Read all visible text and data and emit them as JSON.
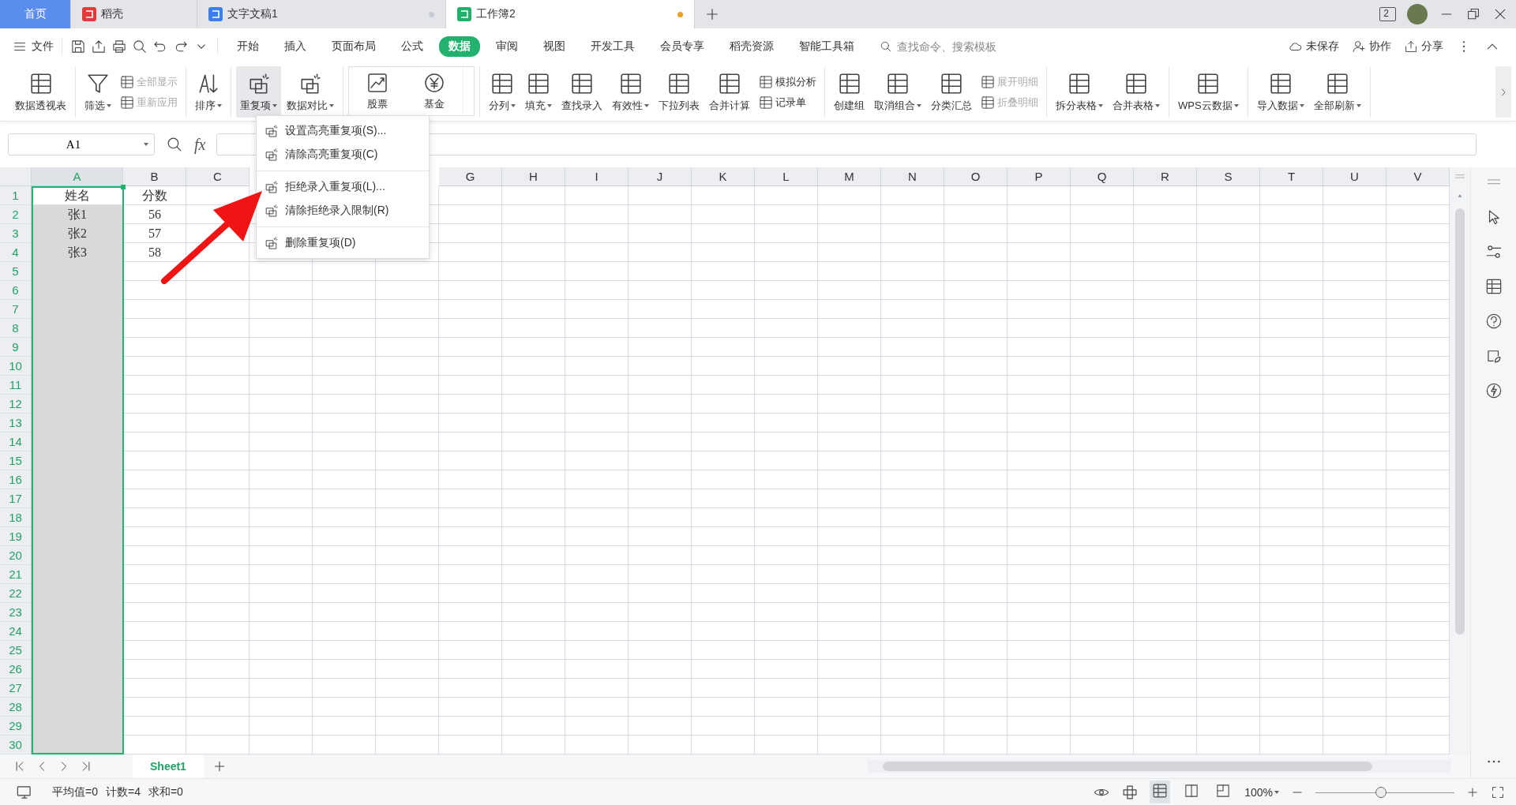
{
  "window_tabs": [
    {
      "kind": "home",
      "label": "首页",
      "selected": false
    },
    {
      "kind": "web",
      "label": "稻壳",
      "selected": false
    },
    {
      "kind": "doc",
      "label": "文字文稿1",
      "selected": false,
      "modified": false
    },
    {
      "kind": "sheet",
      "label": "工作簿2",
      "selected": true,
      "modified": true
    }
  ],
  "window_count": "2",
  "file_menu": "文件",
  "menu_tabs": [
    {
      "label": "开始",
      "selected": false
    },
    {
      "label": "插入",
      "selected": false
    },
    {
      "label": "页面布局",
      "selected": false
    },
    {
      "label": "公式",
      "selected": false
    },
    {
      "label": "数据",
      "selected": true
    },
    {
      "label": "审阅",
      "selected": false
    },
    {
      "label": "视图",
      "selected": false
    },
    {
      "label": "开发工具",
      "selected": false
    },
    {
      "label": "会员专享",
      "selected": false
    },
    {
      "label": "稻壳资源",
      "selected": false
    },
    {
      "label": "智能工具箱",
      "selected": false
    }
  ],
  "search": {
    "placeholder": "查找命令、搜索模板"
  },
  "header_actions": [
    "未保存",
    "协作",
    "分享"
  ],
  "ribbon": [
    {
      "items": [
        {
          "kind": "large",
          "label": "数据透视表",
          "dropdown": false,
          "selected": false
        }
      ]
    },
    {
      "items": [
        {
          "kind": "large",
          "label": "筛选",
          "dropdown": true,
          "selected": false
        },
        {
          "kind": "stack",
          "items": [
            {
              "label": "全部显示",
              "disabled": true
            },
            {
              "label": "重新应用",
              "disabled": true
            }
          ]
        }
      ]
    },
    {
      "items": [
        {
          "kind": "large",
          "label": "排序",
          "dropdown": true,
          "selected": false
        }
      ]
    },
    {
      "items": [
        {
          "kind": "large",
          "label": "重复项",
          "dropdown": true,
          "selected": true
        },
        {
          "kind": "large",
          "label": "数据对比",
          "dropdown": true,
          "selected": false
        }
      ]
    },
    {
      "items": [
        {
          "kind": "gallery",
          "items": [
            {
              "label": "股票"
            },
            {
              "label": "基金"
            }
          ]
        }
      ]
    },
    {
      "items": [
        {
          "kind": "large",
          "label": "分列",
          "dropdown": true,
          "selected": false
        },
        {
          "kind": "large",
          "label": "填充",
          "dropdown": true,
          "selected": false
        },
        {
          "kind": "large",
          "label": "查找录入",
          "dropdown": false,
          "selected": false
        },
        {
          "kind": "large",
          "label": "有效性",
          "dropdown": true,
          "selected": false
        },
        {
          "kind": "large",
          "label": "下拉列表",
          "dropdown": false,
          "selected": false
        },
        {
          "kind": "large",
          "label": "合并计算",
          "dropdown": false,
          "selected": false
        },
        {
          "kind": "stack",
          "items": [
            {
              "label": "模拟分析",
              "disabled": false
            },
            {
              "label": "记录单",
              "disabled": false
            }
          ]
        }
      ]
    },
    {
      "items": [
        {
          "kind": "large",
          "label": "创建组",
          "dropdown": false,
          "selected": false
        },
        {
          "kind": "large",
          "label": "取消组合",
          "dropdown": true,
          "selected": false
        },
        {
          "kind": "large",
          "label": "分类汇总",
          "dropdown": false,
          "selected": false
        },
        {
          "kind": "stack",
          "items": [
            {
              "label": "展开明细",
              "disabled": true
            },
            {
              "label": "折叠明细",
              "disabled": true
            }
          ]
        }
      ]
    },
    {
      "items": [
        {
          "kind": "large",
          "label": "拆分表格",
          "dropdown": true,
          "selected": false
        },
        {
          "kind": "large",
          "label": "合并表格",
          "dropdown": true,
          "selected": false
        }
      ]
    },
    {
      "items": [
        {
          "kind": "large",
          "label": "WPS云数据",
          "dropdown": true,
          "selected": false
        }
      ]
    },
    {
      "items": [
        {
          "kind": "large",
          "label": "导入数据",
          "dropdown": true,
          "selected": false
        },
        {
          "kind": "large",
          "label": "全部刷新",
          "dropdown": true,
          "selected": false
        }
      ]
    }
  ],
  "dropdown_menu": [
    [
      {
        "label": "设置高亮重复项(S)..."
      },
      {
        "label": "清除高亮重复项(C)"
      }
    ],
    [
      {
        "label": "拒绝录入重复项(L)..."
      },
      {
        "label": "清除拒绝录入限制(R)"
      }
    ],
    [
      {
        "label": "删除重复项(D)"
      }
    ]
  ],
  "name_box": {
    "value": "A1"
  },
  "formula_label": "fx",
  "columns": [
    {
      "label": "A",
      "selected": true
    },
    {
      "label": "B",
      "selected": false
    },
    {
      "label": "C",
      "selected": false
    },
    {},
    {},
    {},
    {
      "label": "G",
      "selected": false
    },
    {
      "label": "H",
      "selected": false
    },
    {
      "label": "I",
      "selected": false
    },
    {
      "label": "J",
      "selected": false
    },
    {
      "label": "K",
      "selected": false
    },
    {
      "label": "L",
      "selected": false
    },
    {
      "label": "M",
      "selected": false
    },
    {
      "label": "N",
      "selected": false
    },
    {
      "label": "O",
      "selected": false
    },
    {
      "label": "P",
      "selected": false
    },
    {
      "label": "Q",
      "selected": false
    },
    {
      "label": "R",
      "selected": false
    },
    {
      "label": "S",
      "selected": false
    },
    {
      "label": "T",
      "selected": false
    },
    {
      "label": "U",
      "selected": false
    },
    {
      "label": "V",
      "selected": false
    }
  ],
  "rows": [
    {
      "label": "1",
      "selected": true,
      "cells": [
        "姓名",
        "分数"
      ]
    },
    {
      "label": "2",
      "selected": true,
      "cells": [
        "张1",
        "56"
      ]
    },
    {
      "label": "3",
      "selected": true,
      "cells": [
        "张2",
        "57"
      ]
    },
    {
      "label": "4",
      "selected": true,
      "cells": [
        "张3",
        "58"
      ]
    },
    {
      "label": "5",
      "selected": true
    },
    {
      "label": "6",
      "selected": true
    },
    {
      "label": "7",
      "selected": true
    },
    {
      "label": "8",
      "selected": true
    },
    {
      "label": "9",
      "selected": true
    },
    {
      "label": "10",
      "selected": true
    },
    {
      "label": "11",
      "selected": true
    },
    {
      "label": "12",
      "selected": true
    },
    {
      "label": "13",
      "selected": true
    },
    {
      "label": "14",
      "selected": true
    },
    {
      "label": "15",
      "selected": true
    },
    {
      "label": "16",
      "selected": true
    },
    {
      "label": "17",
      "selected": true
    },
    {
      "label": "18",
      "selected": true
    },
    {
      "label": "19",
      "selected": true
    },
    {
      "label": "20",
      "selected": true
    },
    {
      "label": "21",
      "selected": true
    },
    {
      "label": "22",
      "selected": true
    },
    {
      "label": "23",
      "selected": true
    },
    {
      "label": "24",
      "selected": true
    },
    {
      "label": "25",
      "selected": true
    },
    {
      "label": "26",
      "selected": true
    },
    {
      "label": "27",
      "selected": true
    },
    {
      "label": "28",
      "selected": true
    },
    {
      "label": "29",
      "selected": true
    },
    {
      "label": "30",
      "selected": true
    }
  ],
  "sheet_tabs": [
    {
      "label": "Sheet1",
      "selected": true
    }
  ],
  "status_bar": {
    "stats": [
      "平均值=0",
      "计数=4",
      "求和=0"
    ],
    "zoom": "100%",
    "zoom_slider": {
      "level": 0.47
    }
  }
}
